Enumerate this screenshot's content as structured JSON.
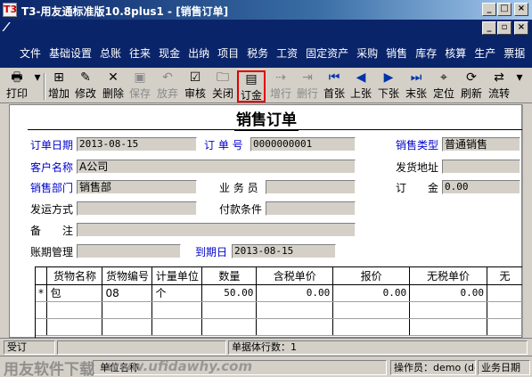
{
  "window": {
    "title": "T3-用友通标准版10.8plus1 - [销售订单]",
    "icon_glyph": "T3",
    "min_glyph": "_",
    "max_glyph": "□",
    "close_glyph": "×",
    "child_restore_glyph": "▫"
  },
  "menu": [
    "文件",
    "基础设置",
    "总账",
    "往来",
    "现金",
    "出纳",
    "项目",
    "税务",
    "工资",
    "固定资产",
    "采购",
    "销售",
    "库存",
    "核算",
    "生产",
    "票据"
  ],
  "toolbar": {
    "print": "打印",
    "add": "增加",
    "modify": "修改",
    "delete": "删除",
    "save": "保存",
    "discard": "放弃",
    "audit": "审核",
    "close": "关闭",
    "order": "订金",
    "add_row": "增行",
    "del_row": "删行",
    "first": "首张",
    "prev": "上张",
    "next": "下张",
    "last": "末张",
    "locate": "定位",
    "refresh": "刷新",
    "flow": "流转"
  },
  "form": {
    "title": "销售订单",
    "order_date_label": "订单日期",
    "order_date": "2013-08-15",
    "order_no_label": "订 单 号",
    "order_no": "0000000001",
    "sales_type_label": "销售类型",
    "sales_type": "普通销售",
    "customer_label": "客户名称",
    "customer": "A公司",
    "ship_addr_label": "发货地址",
    "ship_addr": "",
    "dept_label": "销售部门",
    "dept": "销售部",
    "salesman_label": "业 务 员",
    "salesman": "",
    "deposit_label": "订　　金",
    "deposit": "0.00",
    "ship_method_label": "发运方式",
    "ship_method": "",
    "payment_label": "付款条件",
    "payment": "",
    "remark_label": "备　　注",
    "remark": "",
    "period_label": "账期管理",
    "period": "",
    "due_label": "到期日",
    "due": "2013-08-15"
  },
  "grid": {
    "columns": [
      "",
      "货物名称",
      "货物编号",
      "计量单位",
      "数量",
      "含税单价",
      "报价",
      "无税单价",
      "无"
    ],
    "rows": [
      [
        "*",
        "包",
        "08",
        "个",
        "50.00",
        "0.00",
        "0.00",
        "0.00",
        ""
      ]
    ]
  },
  "status": {
    "left": "受订",
    "rows": "单据体行数：1"
  },
  "footer": {
    "watermark": "用友软件下载",
    "watermark_url": "www.ufidawhy.com",
    "hint": "单位名称",
    "operator": "操作员：demo (de",
    "bizdate": "业务日期"
  }
}
